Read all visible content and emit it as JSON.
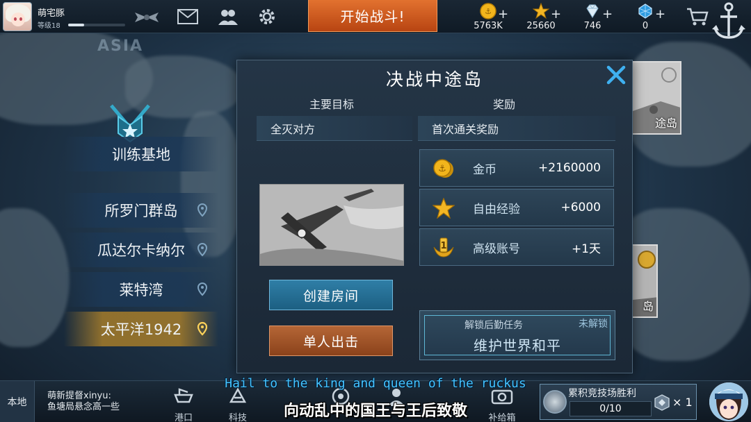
{
  "topbar": {
    "username": "萌宅豚",
    "level": "等级18",
    "level_progress": 0.28,
    "start_battle": "开始战斗!",
    "resources": [
      {
        "icon": "gold-coin-icon",
        "value": "5763K"
      },
      {
        "icon": "star-icon",
        "value": "25660"
      },
      {
        "icon": "diamond-icon",
        "value": "746"
      },
      {
        "icon": "blue-gem-icon",
        "value": "0"
      }
    ],
    "plus": "+"
  },
  "map": {
    "label": "ASIA"
  },
  "left_menu": {
    "header": "训练基地",
    "items": [
      {
        "label": "所罗门群岛"
      },
      {
        "label": "瓜达尔卡纳尔"
      },
      {
        "label": "莱特湾"
      },
      {
        "label": "太平洋1942",
        "active": true
      }
    ]
  },
  "bg_cards": {
    "top_text": "途岛",
    "bottom_text": "岛"
  },
  "dialog": {
    "title": "决战中途岛",
    "objective_head": "主要目标",
    "objective": "全灭对方",
    "reward_head": "奖励",
    "first_clear": "首次通关奖励",
    "rewards": [
      {
        "icon": "gold-coin-icon",
        "name": "金币",
        "value": "+2160000"
      },
      {
        "icon": "star-icon",
        "name": "自由经验",
        "value": "+6000"
      },
      {
        "icon": "premium-medal-icon",
        "name": "高级账号",
        "value": "+1天"
      }
    ],
    "create_room": "创建房间",
    "solo_sortie": "单人出击",
    "unlock_small": "解锁后勤任务",
    "unlock_status": "未解锁",
    "unlock_big": "维护世界和平"
  },
  "bottombar": {
    "local": "本地",
    "chat_line1": "萌新提督xinyu:",
    "chat_line2": "鱼塘局悬念高一些",
    "nav": [
      {
        "label": "港口",
        "icon": "port-icon"
      },
      {
        "label": "科技",
        "icon": "tech-icon"
      },
      {
        "label": "补给箱",
        "icon": "supply-box-icon"
      }
    ],
    "arena_title": "累积竞技场胜利",
    "arena_progress": "0/10",
    "arena_count": "× 1"
  },
  "subtitles": {
    "en": "Hail to the king and queen of the ruckus",
    "zh": "向动乱中的国王与王后致敬"
  },
  "colors": {
    "accent_orange": "#c8581f",
    "accent_blue": "#2f7ea6",
    "close_blue": "#3fb0f0",
    "gold": "#f2b51c"
  }
}
